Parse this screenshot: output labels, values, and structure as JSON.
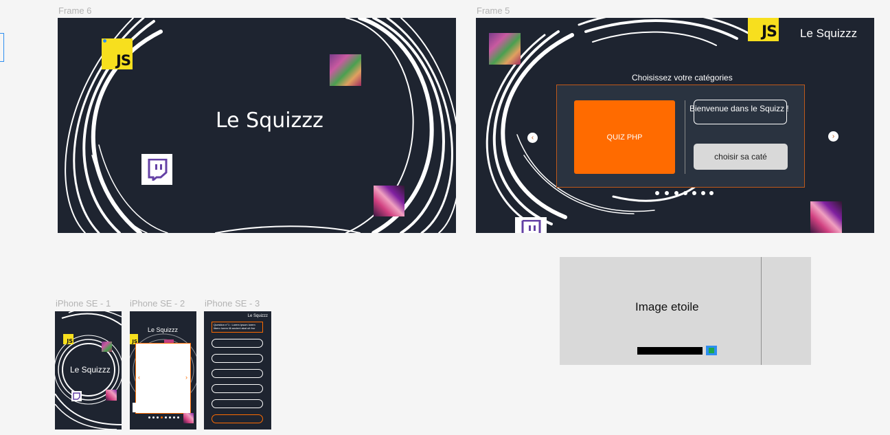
{
  "frames": {
    "frame6": {
      "label": "Frame 6",
      "title": "Le Squizzz",
      "js_logo": "JS"
    },
    "frame5": {
      "label": "Frame 5",
      "header_title": "Le Squizzz",
      "js_logo": "JS",
      "categories_label": "Choisissez votre catégories",
      "quiz_button": "QUIZ PHP",
      "welcome_text": "Bienvenue dans le Squizz !",
      "choose_button": "choisir sa caté",
      "prev_arrow": "‹",
      "next_arrow": "›"
    }
  },
  "image_card": {
    "label": "Image etoile",
    "swatch_color": "#1fa84a"
  },
  "phones": [
    {
      "label": "iPhone SE - 1",
      "title": "Le Squizzz",
      "js_logo": "JS"
    },
    {
      "label": "iPhone SE - 2",
      "title": "Le Squizzz",
      "js_logo": "JS",
      "prev_arrow": "‹",
      "next_arrow": "›"
    },
    {
      "label": "iPhone SE - 3",
      "title": "Le Squizzz",
      "question": "Question n°1 : Lorem ipsum lorem libero lorem illi ancienl akat ult fror"
    }
  ],
  "colors": {
    "frame_bg": "#1e2430",
    "accent_orange": "#ff6b00",
    "js_yellow": "#f7df1e",
    "twitch_purple": "#6441a5",
    "canvas_bg": "#f5f5f5"
  }
}
